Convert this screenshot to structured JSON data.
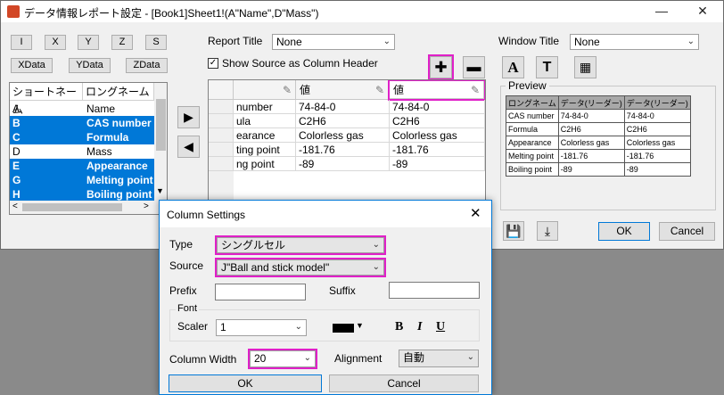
{
  "main_window": {
    "title": "データ情報レポート設定 - [Book1]Sheet1!(A\"Name\",D\"Mass\")",
    "minimize_glyph": "—",
    "close_glyph": "✕"
  },
  "column_buttons": [
    "I",
    "X",
    "Y",
    "Z",
    "S"
  ],
  "data_buttons": [
    "XData",
    "YData",
    "ZData"
  ],
  "name_list": {
    "headers": [
      "ショートネーム",
      "ロングネーム"
    ],
    "rows": [
      {
        "short": "A",
        "long": "Name",
        "selected": false
      },
      {
        "short": "B",
        "long": "CAS number",
        "selected": true
      },
      {
        "short": "C",
        "long": "Formula",
        "selected": true
      },
      {
        "short": "D",
        "long": "Mass",
        "selected": false
      },
      {
        "short": "E",
        "long": "Appearance",
        "selected": true
      },
      {
        "short": "G",
        "long": "Melting point",
        "selected": true
      },
      {
        "short": "H",
        "long": "Boiling point",
        "selected": true
      }
    ]
  },
  "report_title": {
    "label": "Report Title",
    "value": "None"
  },
  "show_source": {
    "label": "Show Source as Column Header",
    "checked": true
  },
  "window_title": {
    "label": "Window Title",
    "value": "None"
  },
  "grid": {
    "headers": [
      "値",
      "値"
    ],
    "rows": [
      [
        "number",
        "74-84-0",
        "74-84-0"
      ],
      [
        "ula",
        "C2H6",
        "C2H6"
      ],
      [
        "earance",
        "Colorless gas",
        "Colorless gas"
      ],
      [
        "ting point",
        "-181.76",
        "-181.76"
      ],
      [
        "ng point",
        "-89",
        "-89"
      ]
    ]
  },
  "preview": {
    "label": "Preview",
    "headers": [
      "ロングネーム",
      "データ(リーダー)",
      "データ(リーダー)"
    ],
    "rows": [
      [
        "CAS number",
        "74-84-0",
        "74-84-0"
      ],
      [
        "Formula",
        "C2H6",
        "C2H6"
      ],
      [
        "Appearance",
        "Colorless gas",
        "Colorless gas"
      ],
      [
        "Melting point",
        "-181.76",
        "-181.76"
      ],
      [
        "Boiling point",
        "-89",
        "-89"
      ]
    ]
  },
  "main_buttons": {
    "ok": "OK",
    "cancel": "Cancel"
  },
  "dialog": {
    "title": "Column Settings",
    "type_label": "Type",
    "type_value": "シングルセル",
    "source_label": "Source",
    "source_value": "J\"Ball and stick model\"",
    "prefix_label": "Prefix",
    "suffix_label": "Suffix",
    "font_group": "Font",
    "scaler_label": "Scaler",
    "scaler_value": "1",
    "bold": "B",
    "italic": "I",
    "underline": "U",
    "width_label": "Column Width",
    "width_value": "20",
    "alignment_label": "Alignment",
    "alignment_value": "自動",
    "ok": "OK",
    "cancel": "Cancel"
  },
  "colors": {
    "selection": "#0078d7",
    "highlight": "#e020c8"
  }
}
